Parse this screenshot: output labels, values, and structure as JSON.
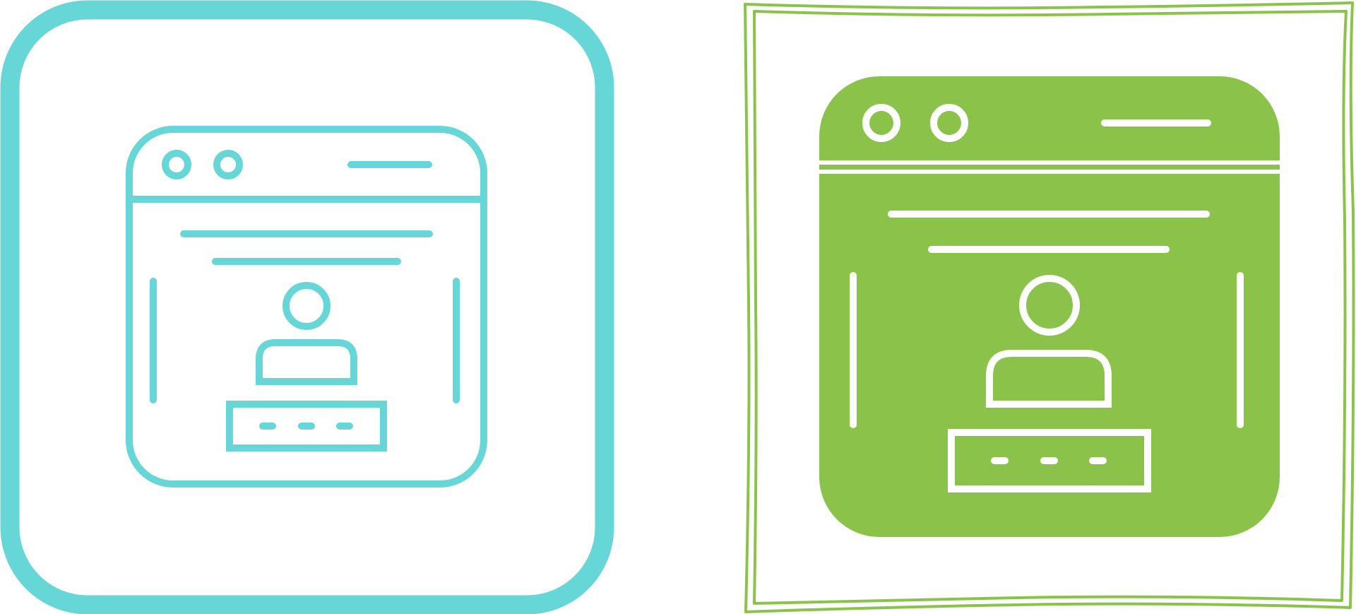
{
  "icons": [
    {
      "name": "login-page-outline-icon",
      "style": "outline",
      "frame": "rounded-square",
      "color": "#66D6D6",
      "fill": "#FFFFFF"
    },
    {
      "name": "login-page-glyph-icon",
      "style": "filled",
      "frame": "hand-drawn-square",
      "color": "#8BC34A",
      "fill": "#8BC34A"
    }
  ],
  "colors": {
    "background": "#FFFFFF",
    "teal": "#66D6D6",
    "green": "#8BC34A",
    "inner_stroke": "#FFFFFF"
  }
}
